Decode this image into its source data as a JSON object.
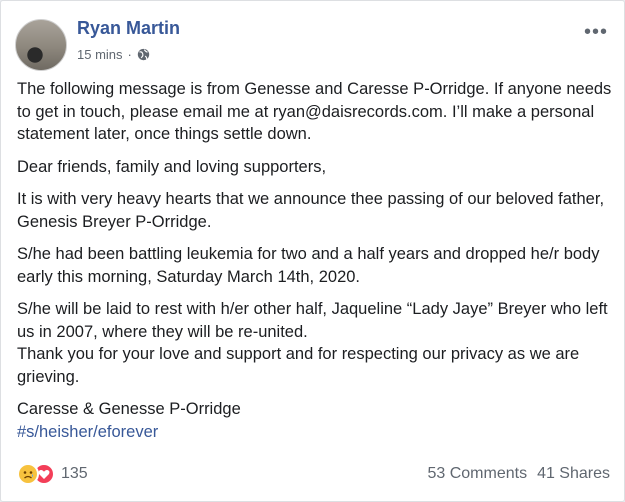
{
  "post": {
    "author": "Ryan Martin",
    "time": "15 mins",
    "separator": "·",
    "privacy_icon": "globe-icon",
    "more_icon": "more-options-icon",
    "more_label": "•••"
  },
  "body": {
    "p1": "The following message is from Genesse and Caresse P-Orridge. If anyone needs to get in touch, please email me at ryan@daisrecords.com. I’ll make a personal statement later, once things settle down.",
    "p2": "Dear friends, family and loving supporters,",
    "p3": "It is with very heavy hearts that we announce thee passing of our beloved father, Genesis Breyer P-Orridge.",
    "p4": "S/he had been battling leukemia for two and a half years and dropped he/r body early this morning, Saturday March 14th, 2020.",
    "p5a": "S/he will be laid to rest with h/er other half, Jaqueline “Lady Jaye” Breyer who left us in 2007, where they will be re-united.",
    "p5b": "Thank you for your love and support and for respecting our privacy as we are grieving.",
    "sign": "Caresse & Genesse P-Orridge",
    "hashtag": "#s/heisher/eforever"
  },
  "footer": {
    "reaction_icons": [
      "sad-reaction-icon",
      "love-reaction-icon"
    ],
    "reaction_count": "135",
    "comments": "53 Comments",
    "shares": "41 Shares"
  },
  "colors": {
    "link": "#385898",
    "text": "#1c1e21",
    "meta": "#606770",
    "sad": "#f7c23e",
    "love": "#f33e58"
  }
}
